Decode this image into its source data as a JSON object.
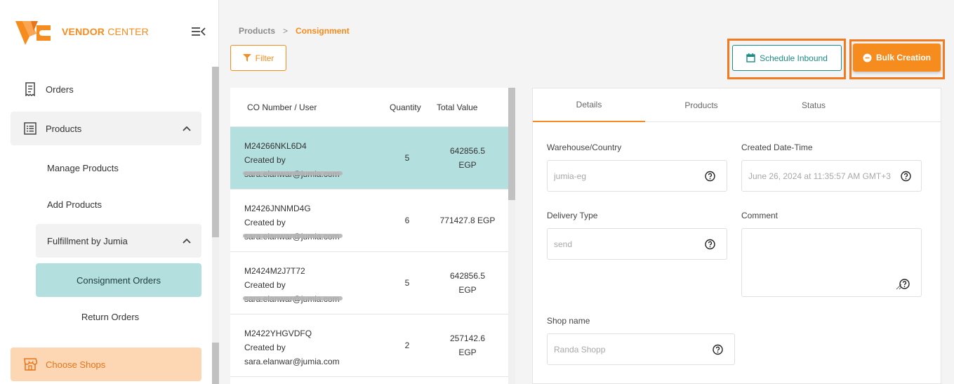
{
  "brand": {
    "name_bold": "VENDOR",
    "name_rest": " CENTER",
    "accent": "#f68b1e",
    "teal": "#1c8c87"
  },
  "sidebar": {
    "items": {
      "orders": "Orders",
      "products": "Products",
      "manage_products": "Manage Products",
      "add_products": "Add Products",
      "fulfillment": "Fulfillment by Jumia",
      "consignment_orders": "Consignment Orders",
      "return_orders": "Return Orders",
      "choose_shops": "Choose Shops"
    }
  },
  "breadcrumb": {
    "parent": "Products",
    "separator": ">",
    "current": "Consignment"
  },
  "toolbar": {
    "filter": "Filter",
    "schedule_inbound": "Schedule Inbound",
    "bulk_creation": "Bulk Creation"
  },
  "list": {
    "columns": {
      "co": "CO Number / User",
      "quantity": "Quantity",
      "total_value": "Total Value"
    },
    "rows": [
      {
        "co": "M24266NKL6D4",
        "created_by": "Created by",
        "email": "sara.elanwar@jumia.com",
        "quantity": "5",
        "value": "642856.5",
        "currency": "EGP"
      },
      {
        "co": "M2426JNNMD4G",
        "created_by": "Created by",
        "email": "sara.elanwar@jumia.com",
        "quantity": "6",
        "value": "771427.8 EGP",
        "currency": ""
      },
      {
        "co": "M2424M2J7T72",
        "created_by": "Created by",
        "email": "sara.elanwar@jumia.com",
        "quantity": "5",
        "value": "642856.5",
        "currency": "EGP"
      },
      {
        "co": "M2422YHGVDFQ",
        "created_by": "Created by",
        "email": "sara.elanwar@jumia.com",
        "quantity": "2",
        "value": "257142.6",
        "currency": "EGP"
      }
    ]
  },
  "details": {
    "tabs": {
      "details": "Details",
      "products": "Products",
      "status": "Status"
    },
    "warehouse": {
      "label": "Warehouse/Country",
      "value": "jumia-eg"
    },
    "created": {
      "label": "Created Date-Time",
      "value": "June 26, 2024 at 11:35:57 AM GMT+3"
    },
    "delivery": {
      "label": "Delivery Type",
      "value": "send"
    },
    "comment": {
      "label": "Comment",
      "value": ""
    },
    "shop": {
      "label": "Shop name",
      "value": "Randa Shopp"
    }
  }
}
